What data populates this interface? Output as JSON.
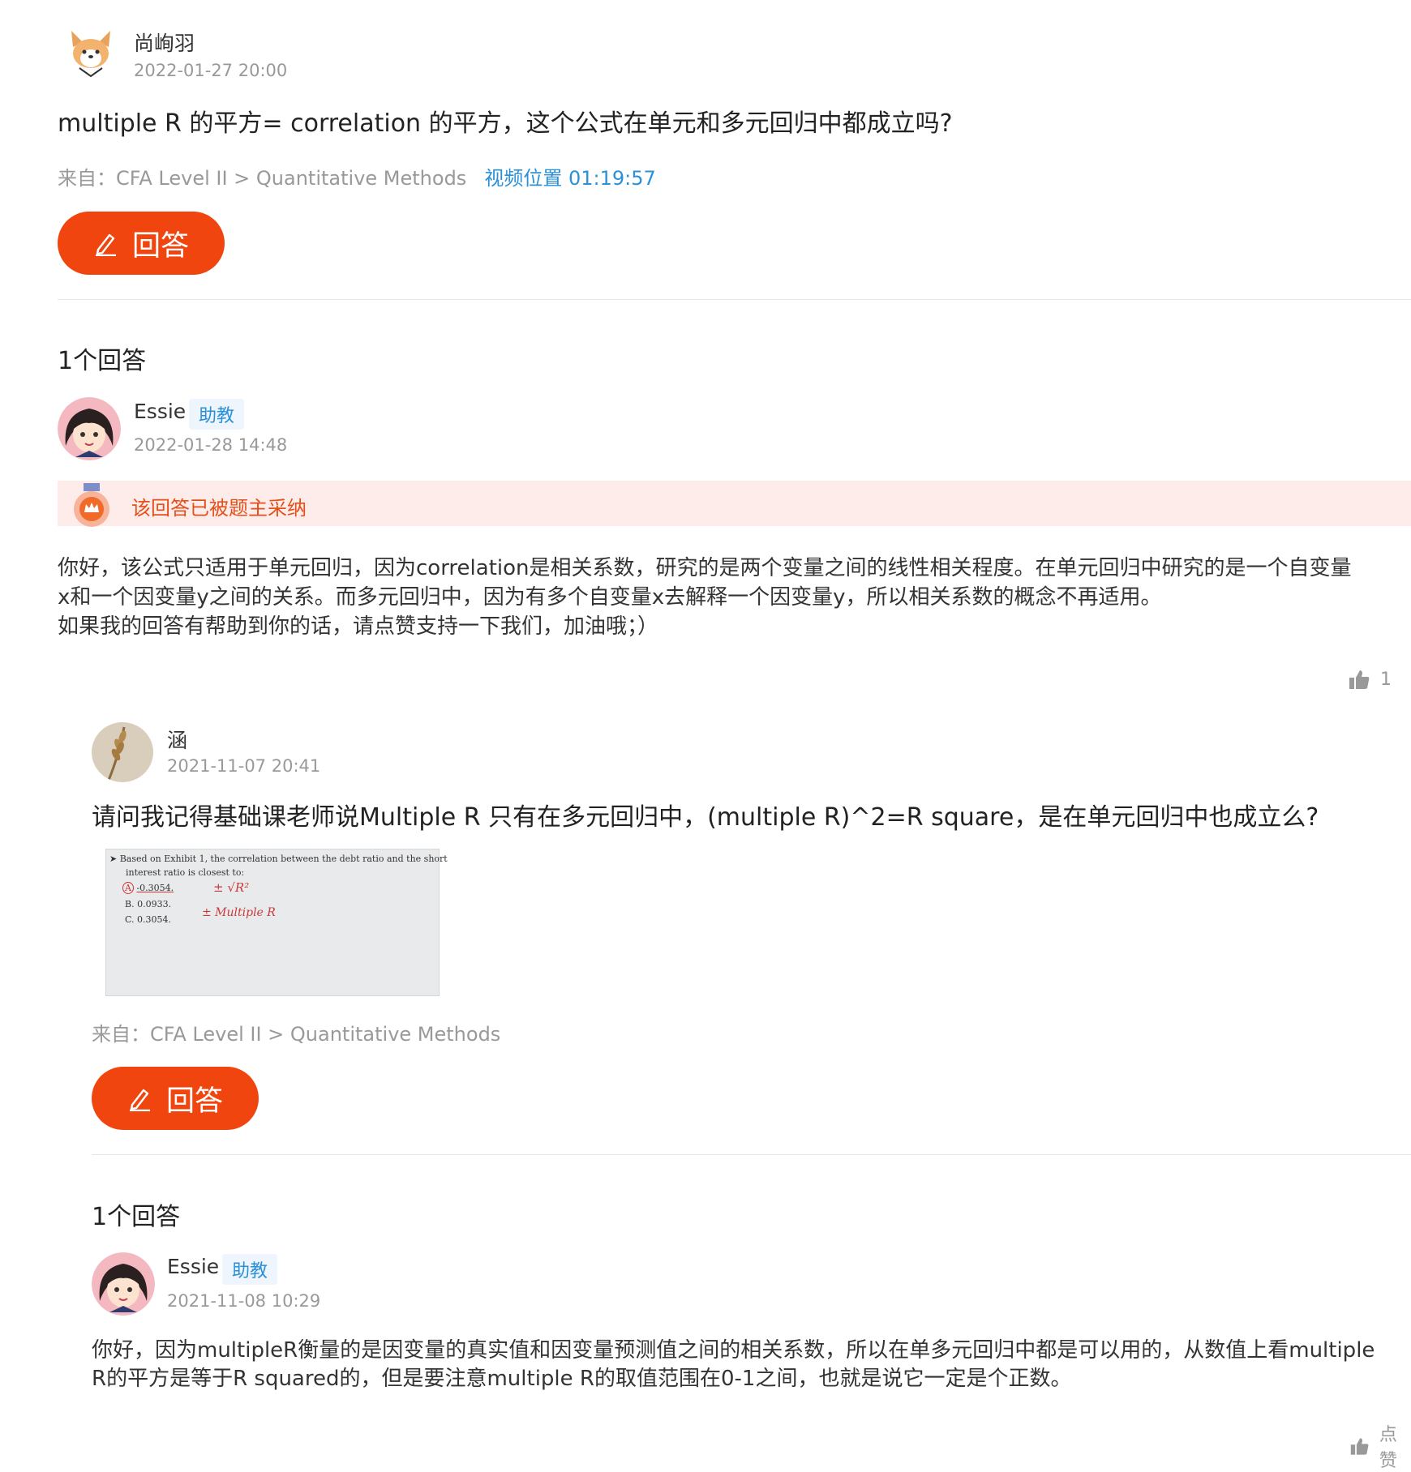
{
  "q1": {
    "user": "尚峋羽",
    "time": "2022-01-27 20:00",
    "question": "multiple R 的平方= correlation 的平方，这个公式在单元和多元回归中都成立吗?",
    "source": "来自：CFA Level II > Quantitative Methods",
    "video_link": "视频位置 01:19:57",
    "answer_button": "回答",
    "answer_count": "1个回答",
    "answer": {
      "user": "Essie",
      "tag": "助教",
      "time": "2022-01-28 14:48",
      "accepted": "该回答已被题主采纳",
      "lines": [
        "你好，该公式只适用于单元回归，因为correlation是相关系数，研究的是两个变量之间的线性相关程度。在单元回归中研究的是一个自变量",
        "x和一个因变量y之间的关系。而多元回归中，因为有多个自变量x去解释一个因变量y，所以相关系数的概念不再适用。",
        "如果我的回答有帮助到你的话，请点赞支持一下我们，加油哦；）"
      ],
      "likes": "1"
    }
  },
  "q2": {
    "user": "涵",
    "time": "2021-11-07 20:41",
    "question": "请问我记得基础课老师说Multiple R 只有在多元回归中，(multiple R)^2=R square，是在单元回归中也成立么?",
    "image": {
      "line1": "➤  Based on Exhibit 1, the correlation between the debt ratio and the short",
      "line2": "interest ratio is closest to:",
      "a": "-0.3054.",
      "b": "0.0933.",
      "c": "0.3054.",
      "note1": "± √R²",
      "note2": "± Multiple R"
    },
    "source": "来自：CFA Level II > Quantitative Methods",
    "answer_button": "回答",
    "answer_count": "1个回答",
    "answer": {
      "user": "Essie",
      "tag": "助教",
      "time": "2021-11-08 10:29",
      "lines": [
        "你好，因为multipleR衡量的是因变量的真实值和因变量预测值之间的相关系数，所以在单多元回归中都是可以用的，从数值上看multiple",
        "R的平方是等于R squared的，但是要注意multiple R的取值范围在0-1之间，也就是说它一定是个正数。"
      ],
      "likes": "点赞"
    }
  },
  "colors": {
    "accent": "#f0450f",
    "link": "#2a90d8",
    "accepted_bg": "#fdecea"
  }
}
